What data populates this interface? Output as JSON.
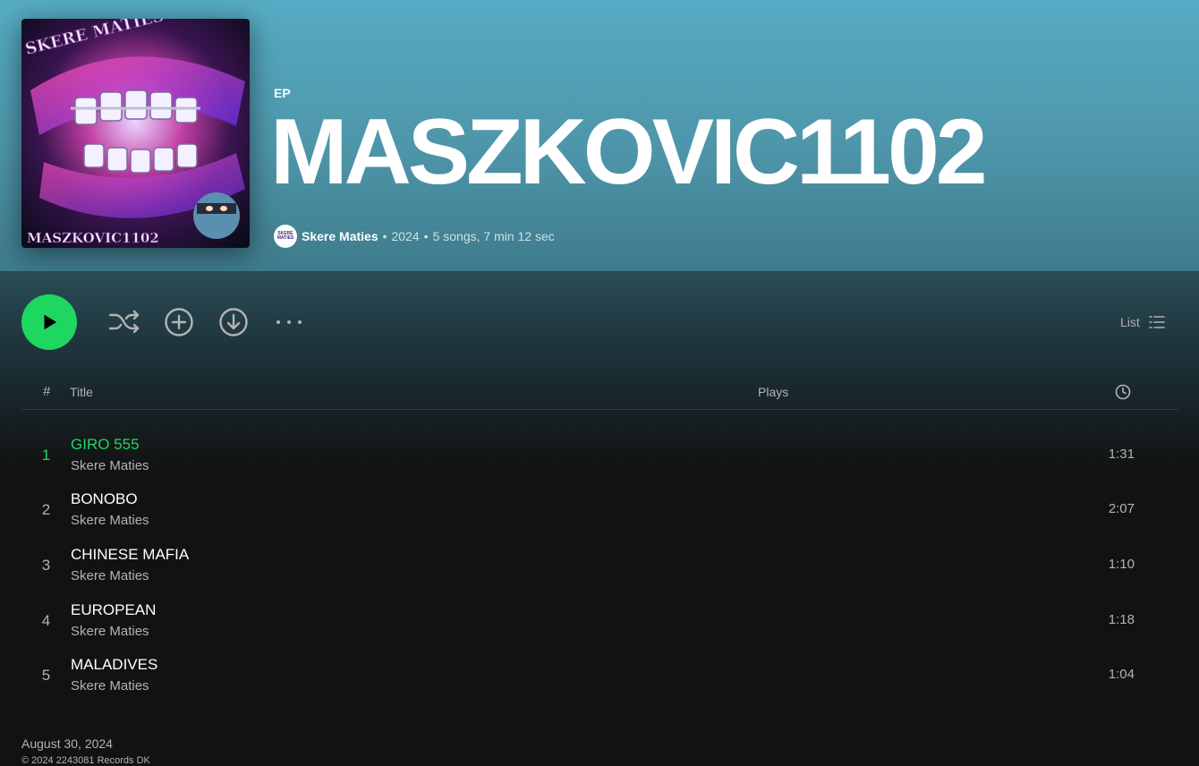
{
  "album": {
    "type": "EP",
    "title": "MASZKOVIC1102",
    "cover_top_text": "SKERE MATIES",
    "cover_bottom_text": "MASZKOVIC1102"
  },
  "meta": {
    "avatar_text": "SKERE MATIES",
    "artist": "Skere Maties",
    "year": "2024",
    "summary": "5 songs, 7 min 12 sec",
    "separator": "•"
  },
  "controls": {
    "play_icon": "play-icon",
    "shuffle_icon": "shuffle-icon",
    "add_icon": "add-circle-icon",
    "download_icon": "download-icon",
    "more_icon": "more-icon",
    "view_label": "List"
  },
  "table": {
    "col_num": "#",
    "col_title": "Title",
    "col_plays": "Plays",
    "col_duration_icon": "clock-icon"
  },
  "tracks": [
    {
      "num": "1",
      "title": "GIRO 555",
      "artist": "Skere Maties",
      "duration": "1:31",
      "playing": true
    },
    {
      "num": "2",
      "title": "BONOBO",
      "artist": "Skere Maties",
      "duration": "2:07"
    },
    {
      "num": "3",
      "title": "CHINESE MAFIA",
      "artist": "Skere Maties",
      "duration": "1:10"
    },
    {
      "num": "4",
      "title": "EUROPEAN",
      "artist": "Skere Maties",
      "duration": "1:18"
    },
    {
      "num": "5",
      "title": "MALADIVES",
      "artist": "Skere Maties",
      "duration": "1:04"
    }
  ],
  "footer": {
    "release_date": "August 30, 2024",
    "copyright": "© 2024 2243081 Records DK"
  },
  "colors": {
    "accent": "#1ed760",
    "header": "#56acc4",
    "background": "#121212"
  }
}
